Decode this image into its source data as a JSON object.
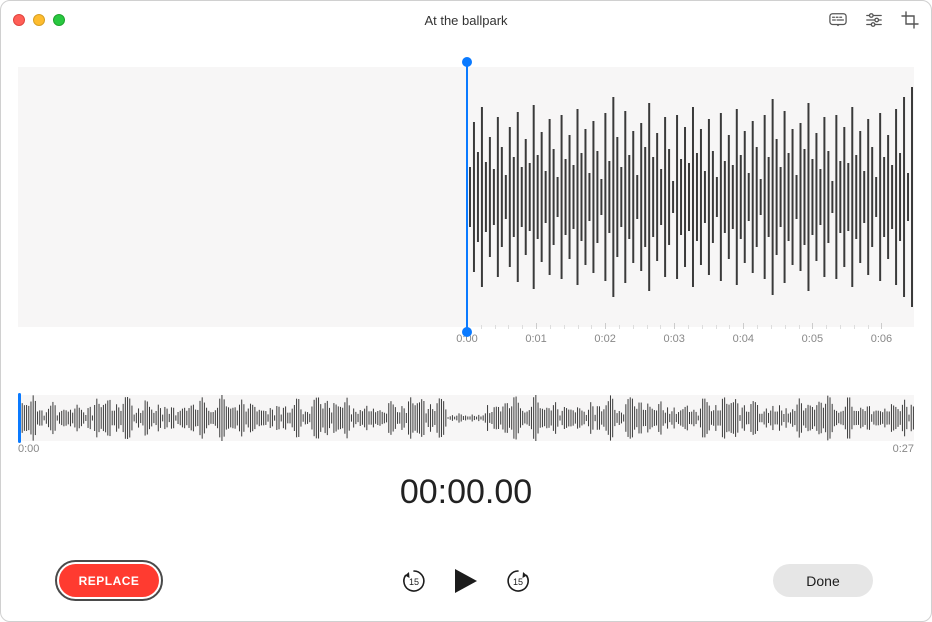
{
  "window": {
    "title": "At the ballpark"
  },
  "mainTimeline": {
    "ticks": [
      "0:00",
      "0:01",
      "0:02",
      "0:03",
      "0:04",
      "0:05",
      "0:06"
    ]
  },
  "overview": {
    "start": "0:00",
    "end": "0:27"
  },
  "timer": {
    "display": "00:00.00"
  },
  "controls": {
    "replace_label": "REPLACE",
    "skip_back_seconds": "15",
    "skip_forward_seconds": "15",
    "done_label": "Done"
  },
  "colors": {
    "accent": "#0a7aff",
    "record": "#ff3b30"
  }
}
